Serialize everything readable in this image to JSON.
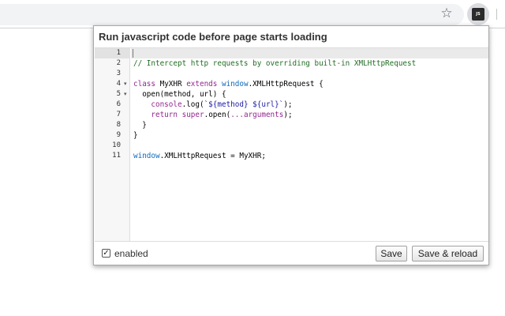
{
  "browser": {
    "extension_icon_text": "JS",
    "bookmark_icon": "star-icon",
    "extension_icon": "js-extension-icon"
  },
  "popup": {
    "title": "Run javascript code before page starts loading",
    "editor": {
      "line_numbers": [
        "1",
        "2",
        "3",
        "4",
        "5",
        "6",
        "7",
        "8",
        "9",
        "10",
        "11"
      ],
      "fold_markers": {
        "4": "▾",
        "5": "▾"
      }
    },
    "footer": {
      "enabled_checked": true,
      "checkbox_mark": "✓",
      "enabled_label": "enabled",
      "save_label": "Save",
      "save_reload_label": "Save & reload"
    }
  },
  "code_tokens": {
    "l2_comment": "// Intercept http requests by overriding built-in XMLHttpRequest",
    "l4_class": "class",
    "l4_name": " MyXHR ",
    "l4_extends": "extends",
    "l4_window": " window",
    "l4_rest": ".XMLHttpRequest {",
    "l5_text": "  open(method, url) {",
    "l6_indent": "    ",
    "l6_console": "console",
    "l6_log": ".log(",
    "l6_string": "`${method} ${url}`",
    "l6_end": ");",
    "l7_indent": "    ",
    "l7_return": "return",
    "l7_space": " ",
    "l7_super": "super",
    "l7_open": ".open(",
    "l7_args": "...arguments",
    "l7_end": ");",
    "l8_text": "  }",
    "l9_text": "}",
    "l11_window": "window",
    "l11_rest": ".XMLHttpRequest = MyXHR;"
  },
  "colors": {
    "comment": "#236e24",
    "keyword": "#93268f",
    "builtin": "#0d6bc0",
    "string": "#1a1aa6"
  }
}
